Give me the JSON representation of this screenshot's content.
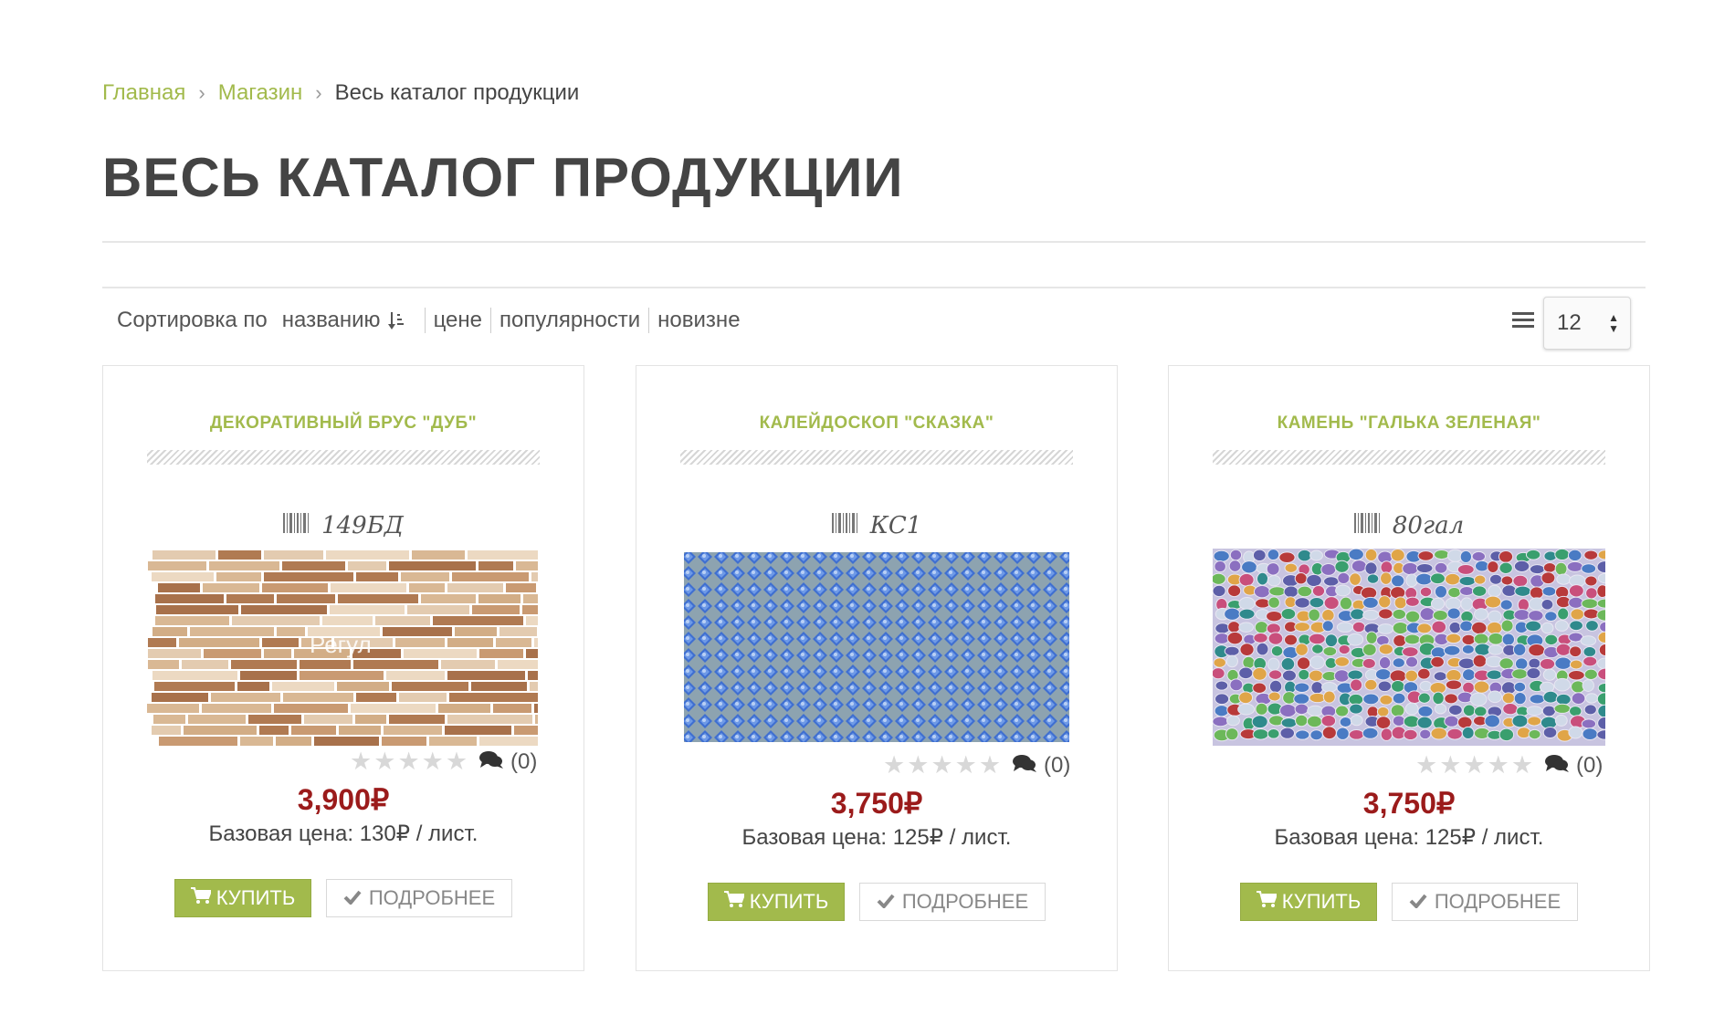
{
  "breadcrumb": {
    "home": "Главная",
    "shop": "Магазин",
    "current": "Весь каталог продукции"
  },
  "page_title": "ВЕСЬ КАТАЛОГ ПРОДУКЦИИ",
  "sort": {
    "label": "Сортировка по",
    "options": [
      "названию",
      "цене",
      "популярности",
      "новизне"
    ],
    "active": "названию"
  },
  "view": {
    "list_icon": "list-icon",
    "per_page": "12"
  },
  "colors": {
    "accent": "#a2ba4c",
    "price": "#9b1b1b"
  },
  "products": [
    {
      "title": "ДЕКОРАТИВНЫЙ БРУС \"ДУБ\"",
      "sku": "149БД",
      "image_watermark": "Регул",
      "rating": 0,
      "comments": "(0)",
      "price": "3,900₽",
      "base_price": "Базовая цена: 130₽ / лист.",
      "buy_label": "КУПИТЬ",
      "more_label": "ПОДРОБНЕЕ"
    },
    {
      "title": "КАЛЕЙДОСКОП \"СКАЗКА\"",
      "sku": "КС1",
      "rating": 0,
      "comments": "(0)",
      "price": "3,750₽",
      "base_price": "Базовая цена: 125₽ / лист.",
      "buy_label": "КУПИТЬ",
      "more_label": "ПОДРОБНЕЕ"
    },
    {
      "title": "КАМЕНЬ \"ГАЛЬКА ЗЕЛЕНАЯ\"",
      "sku": "80гал",
      "rating": 0,
      "comments": "(0)",
      "price": "3,750₽",
      "base_price": "Базовая цена: 125₽ / лист.",
      "buy_label": "КУПИТЬ",
      "more_label": "ПОДРОБНЕЕ"
    }
  ]
}
